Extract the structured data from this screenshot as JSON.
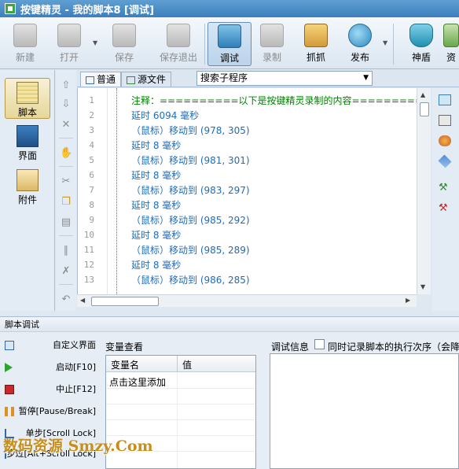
{
  "window": {
    "title": "按键精灵 - 我的脚本8 [调试]"
  },
  "toolbar": {
    "new": "新建",
    "open": "打开",
    "save": "保存",
    "save_exit": "保存退出",
    "debug": "调试",
    "record": "录制",
    "grab": "抓抓",
    "publish": "发布",
    "shield": "神盾",
    "resource": "资"
  },
  "nav": {
    "script": "脚本",
    "interface": "界面",
    "attachment": "附件"
  },
  "editor_tabs": {
    "normal": "普通",
    "source": "源文件",
    "search_sub": "搜索子程序"
  },
  "code": {
    "line_numbers": [
      "1",
      "2",
      "3",
      "4",
      "5",
      "6",
      "7",
      "8",
      "9",
      "10",
      "11",
      "12",
      "13"
    ],
    "lines": [
      "注释：==========以下是按键精灵录制的内容==========",
      "延时 6094 毫秒",
      "（鼠标）移动到 (978, 305)",
      "延时 8 毫秒",
      "（鼠标）移动到 (981, 301)",
      "延时 8 毫秒",
      "（鼠标）移动到 (983, 297)",
      "延时 8 毫秒",
      "（鼠标）移动到 (985, 292)",
      "延时 8 毫秒",
      "（鼠标）移动到 (985, 289)",
      "延时 8 毫秒",
      "（鼠标）移动到 (986, 285)"
    ]
  },
  "debug": {
    "panel_title": "脚本调试",
    "custom_ui": "自定义界面",
    "start": "启动[F10]",
    "stop": "中止[F12]",
    "pause": "暂停[Pause/Break]",
    "step": "单步[Scroll Lock]",
    "step_over": "步过[Alt+Scroll Lock]",
    "var_view": "变量查看",
    "col_name": "变量名",
    "col_value": "值",
    "add_hint": "点击这里添加",
    "info_label": "调试信息",
    "record_order": "同时记录脚本的执行次序（会降"
  },
  "watermark": "数码资源 Smzy.Com",
  "colors": {
    "comment": "#008000",
    "statement": "#1f6cb8",
    "watermark": "#c98d1a"
  }
}
